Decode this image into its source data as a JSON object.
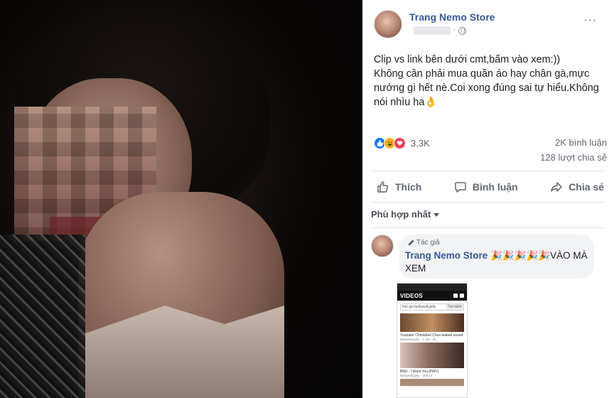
{
  "post": {
    "author": "Trang Nemo Store",
    "meta_dot": "·",
    "more": "···",
    "text_lines": [
      "Clip vs link bên dưới cmt,bấm vào xem:))",
      "Không cần phải mua quần áo hay chân gà,mực",
      "nướng gì hết nè.Coi xong đúng sai tự hiểu.Không",
      "nói nhìu ha👌"
    ],
    "reactions": {
      "icons": [
        "like-icon",
        "haha-icon",
        "love-icon"
      ],
      "count": "3,3K"
    },
    "comments_count": "2K bình luận",
    "shares_count": "128 lượt chia sẻ"
  },
  "actions": {
    "like": "Thích",
    "comment": "Bình luận",
    "share": "Chia sẻ"
  },
  "sort": {
    "label": "Phù hợp nhất"
  },
  "comment": {
    "author_tag": "Tác giả",
    "author": "Trang Nemo Store",
    "text": " 🎉🎉🎉🎉🎉VÀO MÀ XEM"
  },
  "thumbnail": {
    "logo_prefix": "",
    "logo_text": "VIDEOS",
    "search_text": "Hot girl bellywellyjelly",
    "search_button": "Tìm kiếm",
    "caption1": "Youtuber Christabel Chua leaked sound",
    "sub1": "Bellywellyjelly  ·  1,2M  ·  4K",
    "caption2": "BWJ - I Want You [PMV]",
    "sub2": "Bellywellyjelly  ·  305,1K"
  }
}
